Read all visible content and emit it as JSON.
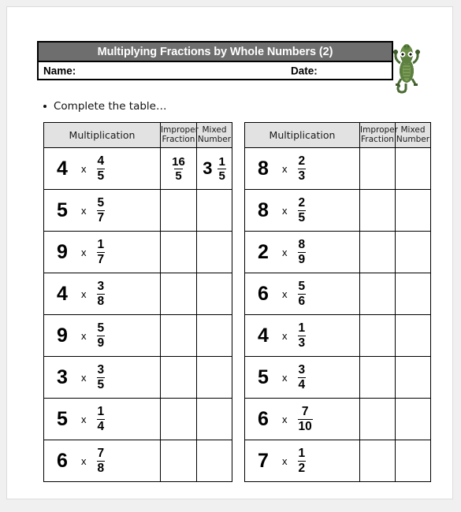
{
  "header": {
    "title": "Multiplying Fractions by Whole Numbers (2)",
    "name_label": "Name:",
    "date_label": "Date:",
    "title_bar_color": "#6e6e6e",
    "title_text_color": "#ffffff",
    "mascot": "crocodile-mascot"
  },
  "instruction": {
    "bullet": "bullet-point",
    "text": "Complete the table…"
  },
  "table_headers": {
    "multiplication": "Multiplication",
    "improper_fraction_line1": "Improper",
    "improper_fraction_line2": "Fraction",
    "mixed_number_line1": "Mixed",
    "mixed_number_line2": "Number",
    "header_fill": "#e2e2e2"
  },
  "symbols": {
    "times": "x"
  },
  "tables": [
    {
      "id": "left",
      "rows": [
        {
          "whole": "4",
          "num": "4",
          "den": "5",
          "improper_num": "16",
          "improper_den": "5",
          "mixed_whole": "3",
          "mixed_num": "1",
          "mixed_den": "5"
        },
        {
          "whole": "5",
          "num": "5",
          "den": "7",
          "improper_num": "",
          "improper_den": "",
          "mixed_whole": "",
          "mixed_num": "",
          "mixed_den": ""
        },
        {
          "whole": "9",
          "num": "1",
          "den": "7",
          "improper_num": "",
          "improper_den": "",
          "mixed_whole": "",
          "mixed_num": "",
          "mixed_den": ""
        },
        {
          "whole": "4",
          "num": "3",
          "den": "8",
          "improper_num": "",
          "improper_den": "",
          "mixed_whole": "",
          "mixed_num": "",
          "mixed_den": ""
        },
        {
          "whole": "9",
          "num": "5",
          "den": "9",
          "improper_num": "",
          "improper_den": "",
          "mixed_whole": "",
          "mixed_num": "",
          "mixed_den": ""
        },
        {
          "whole": "3",
          "num": "3",
          "den": "5",
          "improper_num": "",
          "improper_den": "",
          "mixed_whole": "",
          "mixed_num": "",
          "mixed_den": ""
        },
        {
          "whole": "5",
          "num": "1",
          "den": "4",
          "improper_num": "",
          "improper_den": "",
          "mixed_whole": "",
          "mixed_num": "",
          "mixed_den": ""
        },
        {
          "whole": "6",
          "num": "7",
          "den": "8",
          "improper_num": "",
          "improper_den": "",
          "mixed_whole": "",
          "mixed_num": "",
          "mixed_den": ""
        }
      ]
    },
    {
      "id": "right",
      "rows": [
        {
          "whole": "8",
          "num": "2",
          "den": "3",
          "improper_num": "",
          "improper_den": "",
          "mixed_whole": "",
          "mixed_num": "",
          "mixed_den": ""
        },
        {
          "whole": "8",
          "num": "2",
          "den": "5",
          "improper_num": "",
          "improper_den": "",
          "mixed_whole": "",
          "mixed_num": "",
          "mixed_den": ""
        },
        {
          "whole": "2",
          "num": "8",
          "den": "9",
          "improper_num": "",
          "improper_den": "",
          "mixed_whole": "",
          "mixed_num": "",
          "mixed_den": ""
        },
        {
          "whole": "6",
          "num": "5",
          "den": "6",
          "improper_num": "",
          "improper_den": "",
          "mixed_whole": "",
          "mixed_num": "",
          "mixed_den": ""
        },
        {
          "whole": "4",
          "num": "1",
          "den": "3",
          "improper_num": "",
          "improper_den": "",
          "mixed_whole": "",
          "mixed_num": "",
          "mixed_den": ""
        },
        {
          "whole": "5",
          "num": "3",
          "den": "4",
          "improper_num": "",
          "improper_den": "",
          "mixed_whole": "",
          "mixed_num": "",
          "mixed_den": ""
        },
        {
          "whole": "6",
          "num": "7",
          "den": "10",
          "improper_num": "",
          "improper_den": "",
          "mixed_whole": "",
          "mixed_num": "",
          "mixed_den": ""
        },
        {
          "whole": "7",
          "num": "1",
          "den": "2",
          "improper_num": "",
          "improper_den": "",
          "mixed_whole": "",
          "mixed_num": "",
          "mixed_den": ""
        }
      ]
    }
  ]
}
